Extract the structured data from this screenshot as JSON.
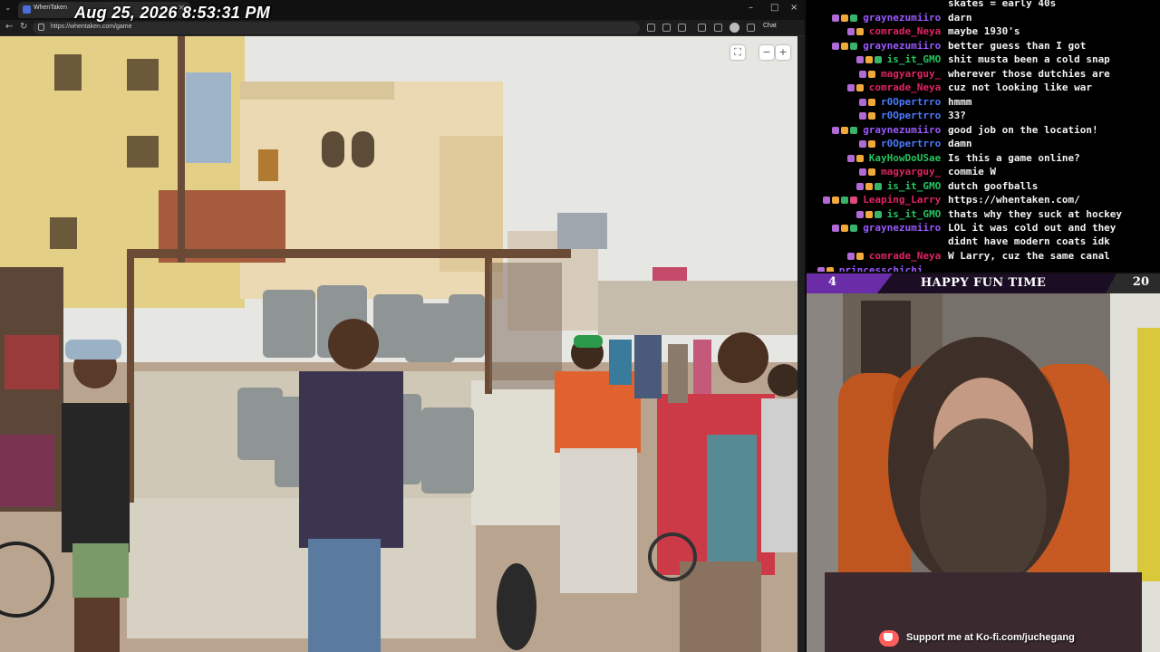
{
  "overlay": {
    "clock": "Aug 25, 2026 8:53:31 PM"
  },
  "browser": {
    "tab_title": "WhenTaken",
    "url": "https://whentaken.com/game",
    "chat_button": "Chat",
    "icons": [
      "back-arrow-icon",
      "forward-arrow-icon",
      "refresh-icon",
      "lock-icon",
      "extension-icon",
      "star-icon",
      "profile-avatar-icon",
      "minimize-icon",
      "maximize-icon",
      "close-icon"
    ]
  },
  "game": {
    "controls": [
      "fullscreen-icon",
      "zoom-out-icon",
      "zoom-in-icon"
    ]
  },
  "chat": {
    "messages": [
      {
        "user": "",
        "text": "skates = early 40s",
        "color": "#ffffff",
        "badges": 0
      },
      {
        "user": "graynezumiiro",
        "text": "darn",
        "color": "#9b59ff",
        "badges": 3
      },
      {
        "user": "comrade_Neya",
        "text": "maybe 1930's",
        "color": "#e0245e",
        "badges": 2
      },
      {
        "user": "graynezumiiro",
        "text": "better guess than I got",
        "color": "#9b59ff",
        "badges": 3
      },
      {
        "user": "is_it_GMO",
        "text": "shit musta been a cold snap",
        "color": "#22c55e",
        "badges": 3
      },
      {
        "user": "magyarguy_",
        "text": "wherever those dutchies are",
        "color": "#e0245e",
        "badges": 2
      },
      {
        "user": "comrade_Neya",
        "text": "cuz not looking like war",
        "color": "#e0245e",
        "badges": 2
      },
      {
        "user": "r0Opertrro",
        "text": "hmmm",
        "color": "#4b7bff",
        "badges": 2
      },
      {
        "user": "r0Opertrro",
        "text": "33?",
        "color": "#4b7bff",
        "badges": 2
      },
      {
        "user": "graynezumiiro",
        "text": "good job on the location!",
        "color": "#9b59ff",
        "badges": 3
      },
      {
        "user": "r0Opertrro",
        "text": "damn",
        "color": "#4b7bff",
        "badges": 2
      },
      {
        "user": "KayHowDoUSae",
        "text": "Is this a game online?",
        "color": "#22c55e",
        "badges": 2
      },
      {
        "user": "magyarguy_",
        "text": "commie W",
        "color": "#e0245e",
        "badges": 2
      },
      {
        "user": "is_it_GMO",
        "text": "dutch goofballs",
        "color": "#22c55e",
        "badges": 3
      },
      {
        "user": "Leaping_Larry",
        "text": "https://whentaken.com/",
        "color": "#e0245e",
        "badges": 4
      },
      {
        "user": "is_it_GMO",
        "text": "thats why they suck at hockey",
        "color": "#22c55e",
        "badges": 3
      },
      {
        "user": "graynezumiiro",
        "text": "LOL it was cold out and they",
        "text2": "didnt have modern coats idk",
        "color": "#9b59ff",
        "badges": 3
      },
      {
        "user": "comrade_Neya",
        "text": "W Larry, cuz the same canal",
        "color": "#e0245e",
        "badges": 2
      },
      {
        "user": "princesschichi...",
        "text": "",
        "color": "#9b59ff",
        "badges": 2
      }
    ]
  },
  "webcam": {
    "left_count": "4",
    "title": "HAPPY FUN TIME",
    "right_count": "20",
    "kofi_text": "Support me at Ko-fi.com/juchegang"
  },
  "colors": {
    "accent_purple": "#6b2ca8",
    "kofi_red": "#ff5e5b",
    "chat_bg": "#000000"
  }
}
